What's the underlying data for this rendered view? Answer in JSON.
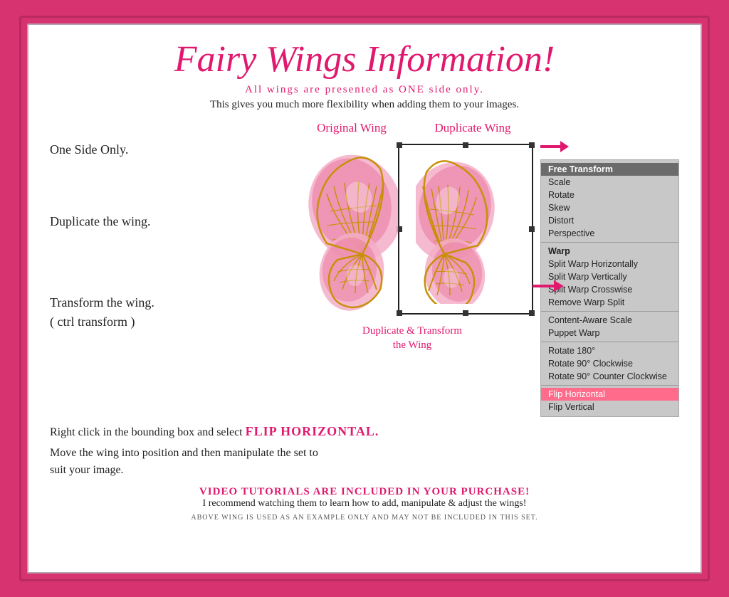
{
  "page": {
    "title": "Fairy Wings Information!",
    "subtitle1": "All wings are presented as ONE side only.",
    "subtitle2": "This gives you much more flexibility when adding them to your images.",
    "labels": {
      "one_side": "One Side Only.",
      "duplicate": "Duplicate the wing.",
      "transform": "Transform the wing.\n( ctrl transform )",
      "original_wing": "Original Wing",
      "duplicate_wing": "Duplicate Wing",
      "dup_transform": "Duplicate & Transform\nthe Wing"
    },
    "flip_text_before": "Right click in the bounding box and select",
    "flip_text_highlight": "FLIP HORIZONTAL.",
    "move_text": "Move the wing into position and then manipulate the set to\nsuit your image.",
    "video_title": "VIDEO TUTORIALS ARE INCLUDED IN YOUR PURCHASE!",
    "video_subtitle": "I recommend watching them to learn how to add, manipulate & adjust the wings!",
    "footer": "ABOVE WING IS USED AS AN EXAMPLE ONLY AND MAY NOT BE INCLUDED IN THIS SET.",
    "menu": {
      "items": [
        {
          "label": "Free Transform",
          "type": "selected"
        },
        {
          "label": "Scale",
          "type": "normal"
        },
        {
          "label": "Rotate",
          "type": "normal"
        },
        {
          "label": "Skew",
          "type": "normal"
        },
        {
          "label": "Distort",
          "type": "normal"
        },
        {
          "label": "Perspective",
          "type": "normal"
        },
        {
          "label": "divider"
        },
        {
          "label": "Warp",
          "type": "bold"
        },
        {
          "label": "Split Warp Horizontally",
          "type": "normal"
        },
        {
          "label": "Split Warp Vertically",
          "type": "normal"
        },
        {
          "label": "Split Warp Crosswise",
          "type": "normal"
        },
        {
          "label": "Remove Warp Split",
          "type": "normal"
        },
        {
          "label": "divider"
        },
        {
          "label": "Content-Aware Scale",
          "type": "normal"
        },
        {
          "label": "Puppet Warp",
          "type": "normal"
        },
        {
          "label": "divider"
        },
        {
          "label": "Rotate 180°",
          "type": "normal"
        },
        {
          "label": "Rotate 90° Clockwise",
          "type": "normal"
        },
        {
          "label": "Rotate 90° Counter Clockwise",
          "type": "normal"
        },
        {
          "label": "divider"
        },
        {
          "label": "Flip Horizontal",
          "type": "highlighted"
        },
        {
          "label": "Flip Vertical",
          "type": "normal"
        }
      ]
    }
  }
}
